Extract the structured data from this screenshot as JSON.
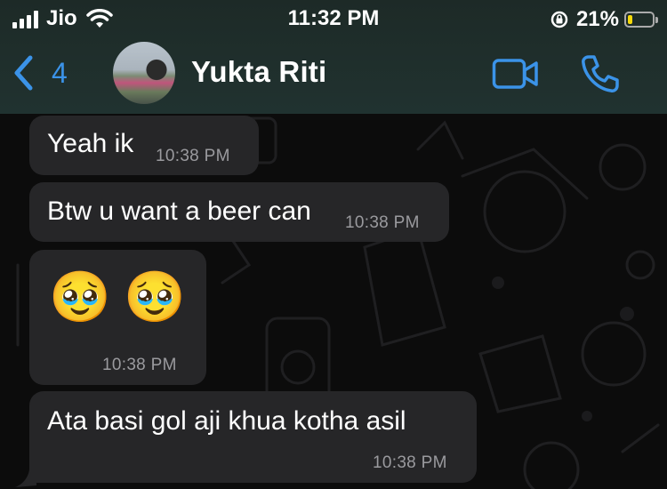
{
  "status_bar": {
    "carrier": "Jio",
    "time": "11:32 PM",
    "battery_percent": "21%",
    "battery_level": 0.21,
    "battery_color": "#f5d90a"
  },
  "header": {
    "back_count": "4",
    "contact_name": "Yukta Riti",
    "accent_color": "#3b93e8",
    "icons": [
      "chevron-left-icon",
      "video-call-icon",
      "phone-icon"
    ]
  },
  "messages": [
    {
      "text": "Yeah ik",
      "time": "10:38 PM"
    },
    {
      "text": "Btw u want a beer can",
      "time": "10:38 PM"
    },
    {
      "text": "🥹 🥹",
      "emojis": [
        "🥹",
        "🥹"
      ],
      "time": "10:38 PM"
    },
    {
      "text": "Ata basi gol aji khua kotha asil",
      "time": "10:38 PM"
    }
  ]
}
